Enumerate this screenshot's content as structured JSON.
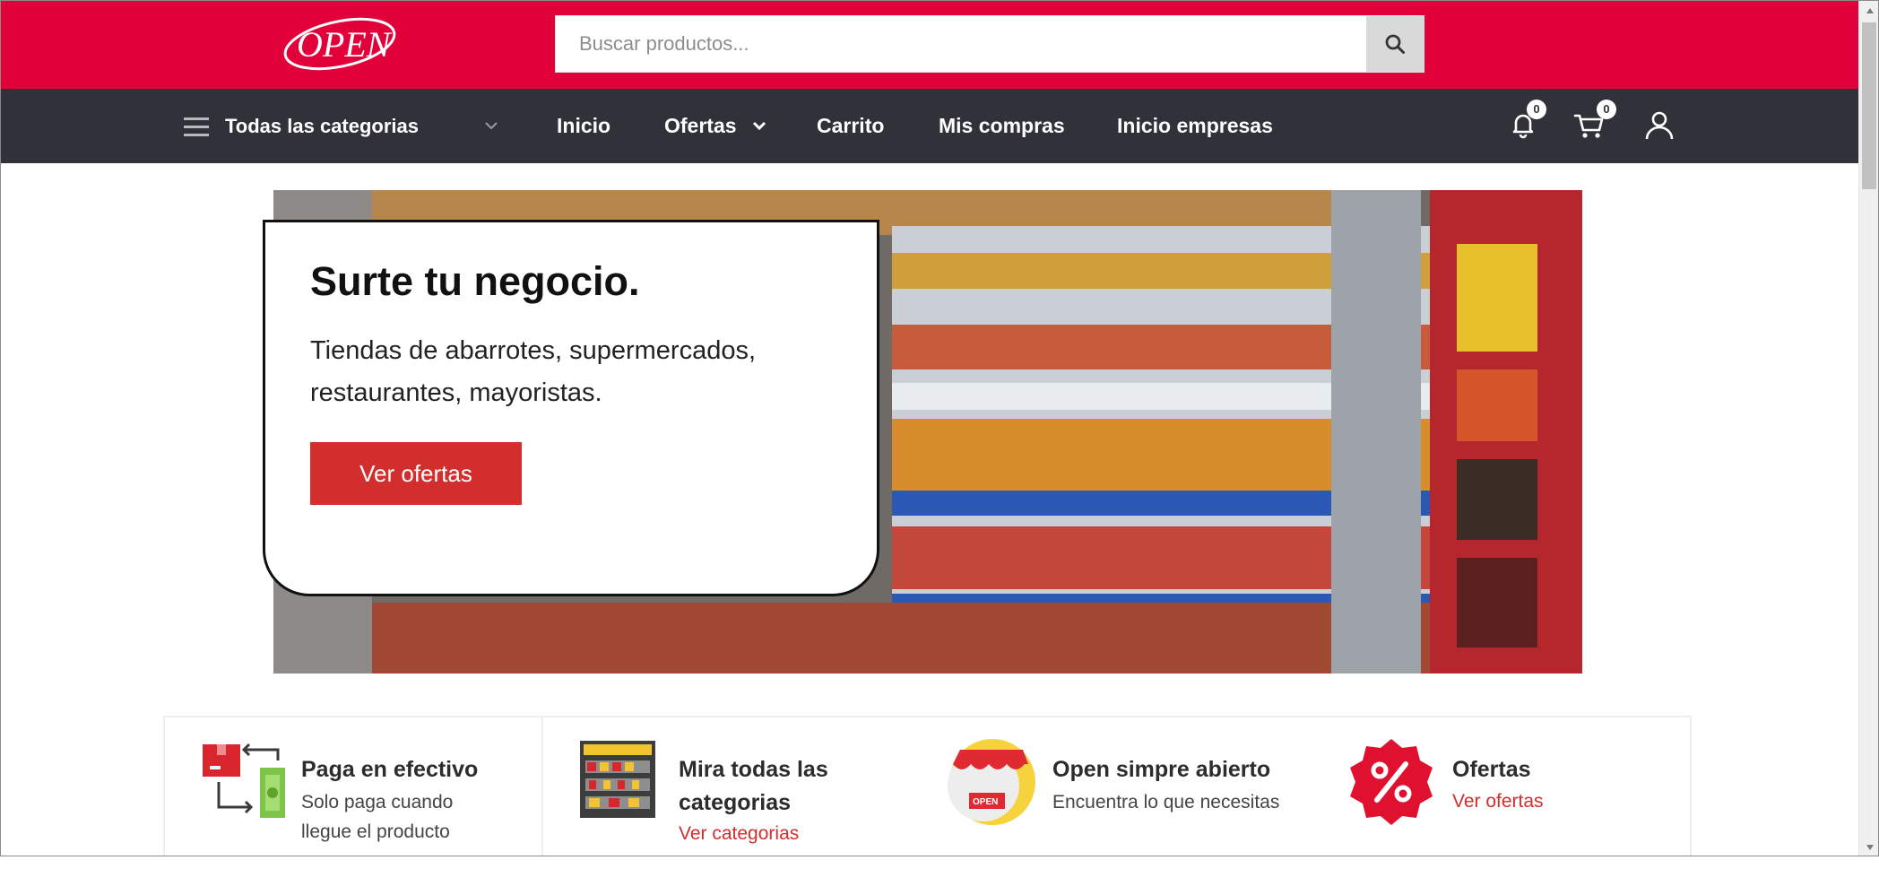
{
  "header": {
    "logo_text": "OPEN",
    "search": {
      "placeholder": "Buscar productos...",
      "value": ""
    }
  },
  "nav": {
    "categories_label": "Todas las categorias",
    "items": [
      {
        "label": "Inicio"
      },
      {
        "label": "Ofertas",
        "has_dropdown": true
      },
      {
        "label": "Carrito"
      },
      {
        "label": "Mis compras"
      },
      {
        "label": "Inicio empresas"
      }
    ],
    "notifications_count": "0",
    "cart_count": "0"
  },
  "hero": {
    "title": "Surte tu negocio.",
    "subtitle": "Tiendas de abarrotes, supermercados, restaurantes, mayoristas.",
    "button_label": "Ver ofertas",
    "slides": 3,
    "active_slide": 1
  },
  "features": [
    {
      "icon": "cash-payment-icon",
      "title": "Paga en efectivo",
      "text": "Solo paga cuando llegue el producto"
    },
    {
      "icon": "shelves-icon",
      "title": "Mira todas las categorias",
      "link": "Ver categorias"
    },
    {
      "icon": "open-store-icon",
      "title": "Open simpre abierto",
      "text": "Encuentra lo que necesitas"
    },
    {
      "icon": "percent-badge-icon",
      "title": "Ofertas",
      "link": "Ver ofertas"
    }
  ],
  "colors": {
    "brand_red": "#e1003a",
    "nav_dark": "#303139",
    "button_red": "#d22e2e"
  }
}
